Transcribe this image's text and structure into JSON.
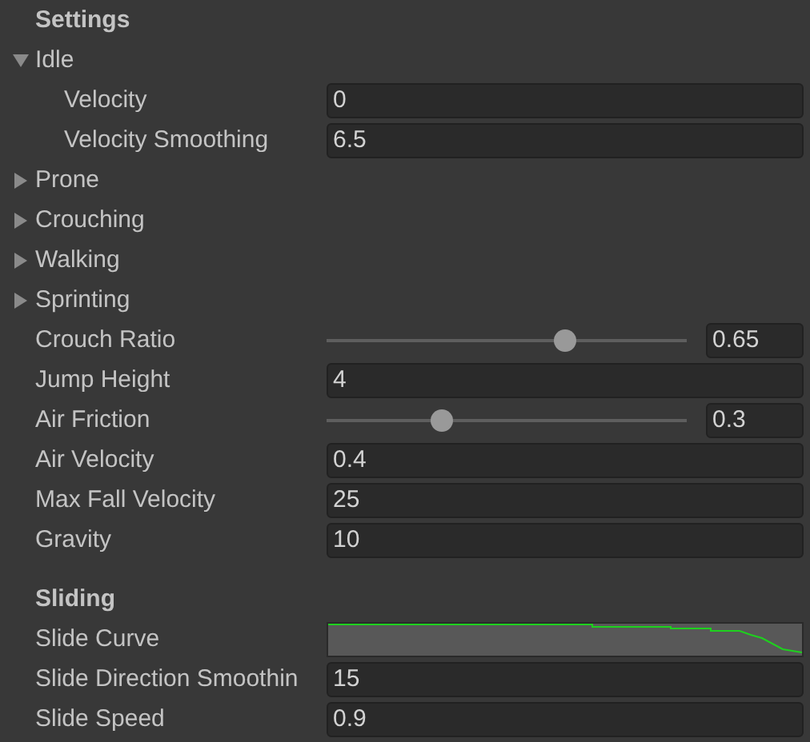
{
  "sections": [
    {
      "title": "Settings",
      "items": [
        {
          "kind": "foldout",
          "label": "Idle",
          "expanded": true,
          "children": [
            {
              "kind": "field",
              "label": "Velocity",
              "value": "0"
            },
            {
              "kind": "field",
              "label": "Velocity Smoothing",
              "value": "6.5"
            }
          ]
        },
        {
          "kind": "foldout",
          "label": "Prone",
          "expanded": false
        },
        {
          "kind": "foldout",
          "label": "Crouching",
          "expanded": false
        },
        {
          "kind": "foldout",
          "label": "Walking",
          "expanded": false
        },
        {
          "kind": "foldout",
          "label": "Sprinting",
          "expanded": false
        },
        {
          "kind": "slider",
          "label": "Crouch Ratio",
          "level": 0.65,
          "value": "0.65"
        },
        {
          "kind": "field",
          "label": "Jump Height",
          "value": "4"
        },
        {
          "kind": "slider",
          "label": "Air Friction",
          "level": 0.3,
          "value": "0.3"
        },
        {
          "kind": "field",
          "label": "Air Velocity",
          "value": "0.4"
        },
        {
          "kind": "field",
          "label": "Max Fall Velocity",
          "value": "25"
        },
        {
          "kind": "field",
          "label": "Gravity",
          "value": "10"
        }
      ]
    },
    {
      "title": "Sliding",
      "items": [
        {
          "kind": "curve",
          "label": "Slide Curve"
        },
        {
          "kind": "field",
          "label": "Slide Direction Smoothin",
          "value": "15"
        },
        {
          "kind": "field",
          "label": "Slide Speed",
          "value": "0.9"
        }
      ]
    }
  ]
}
